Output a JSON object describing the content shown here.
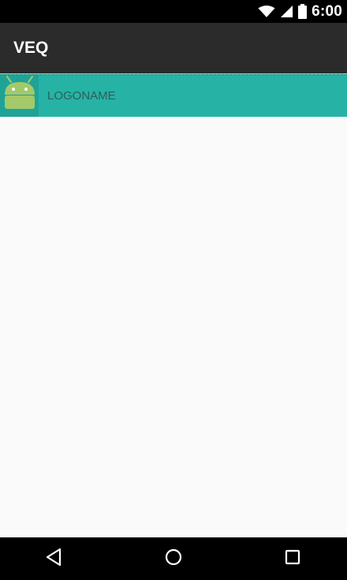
{
  "status_bar": {
    "time": "6:00",
    "icons": [
      "wifi-icon",
      "signal-icon",
      "battery-icon"
    ]
  },
  "app_bar": {
    "title": "VEQ"
  },
  "list": {
    "items": [
      {
        "label": "LOGONAME",
        "icon": "android-icon"
      }
    ]
  },
  "nav_bar": {
    "buttons": [
      "back-icon",
      "home-icon",
      "recents-icon"
    ]
  },
  "colors": {
    "status_bar": "#000000",
    "app_bar": "#2b2b2b",
    "list_item": "#26b3a5",
    "background": "#fafafa",
    "nav_bar": "#000000"
  }
}
